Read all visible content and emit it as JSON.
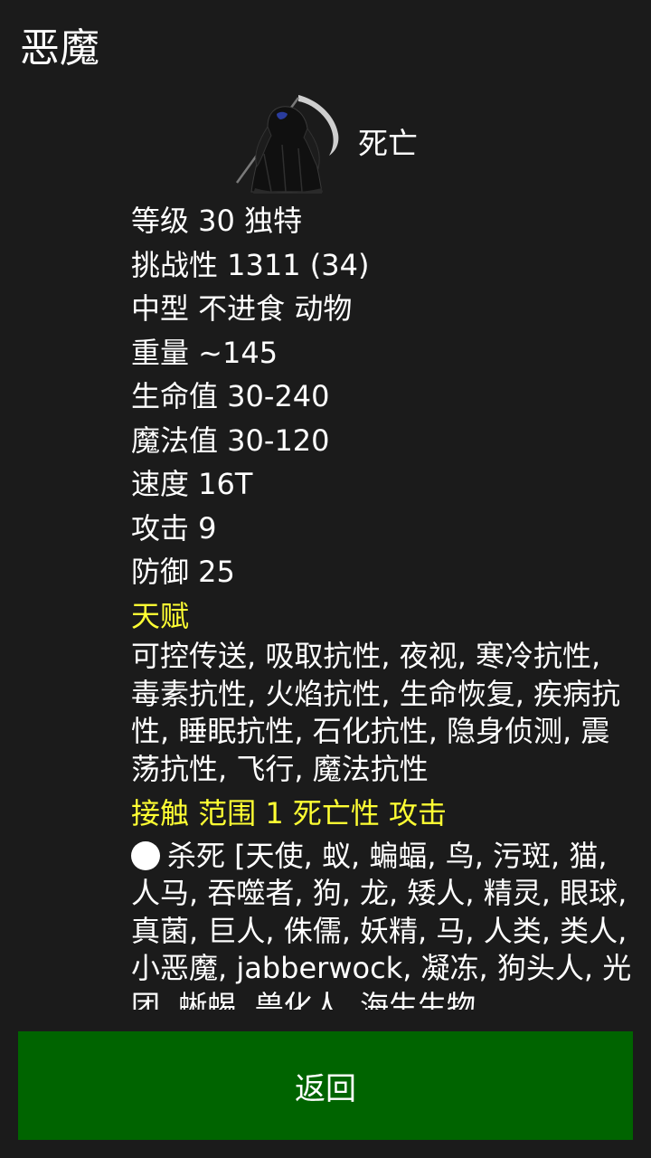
{
  "header": {
    "title": "恶魔"
  },
  "monster": {
    "name": "死亡",
    "portrait_icon": "grim-reaper-icon"
  },
  "stats": {
    "level": "等级 30 独特",
    "challenge": "挑战性 1311 (34)",
    "size_diet_type": "中型 不进食 动物",
    "weight": "重量 ~145",
    "hp": "生命值 30-240",
    "mp": "魔法值 30-120",
    "speed": "速度 16T",
    "attack": "攻击 9",
    "defense": "防御 25"
  },
  "talents": {
    "heading": "天赋",
    "text": "可控传送, 吸取抗性, 夜视, 寒冷抗性, 毒素抗性, 火焰抗性, 生命恢复, 疾病抗性, 睡眠抗性, 石化抗性, 隐身侦测, 震荡抗性, 飞行, 魔法抗性"
  },
  "attack_section": {
    "heading": "接触 范围 1 死亡性 攻击",
    "effect_text": "杀死 [天使, 蚁, 蝙蝠, 鸟, 污斑, 猫, 人马, 吞噬者, 狗, 龙, 矮人, 精灵, 眼球, 真菌, 巨人, 侏儒, 妖精, 马, 人类, 类人, 小恶魔, jabberwock, 凝冻, 狗头人, 光团, 蜥蜴, 兽化人, 海生生物"
  },
  "footer": {
    "back_label": "返回"
  },
  "colors": {
    "background": "#1b1b1b",
    "accent_yellow": "#ffff33",
    "button_green": "#006400",
    "text": "#ffffff"
  }
}
